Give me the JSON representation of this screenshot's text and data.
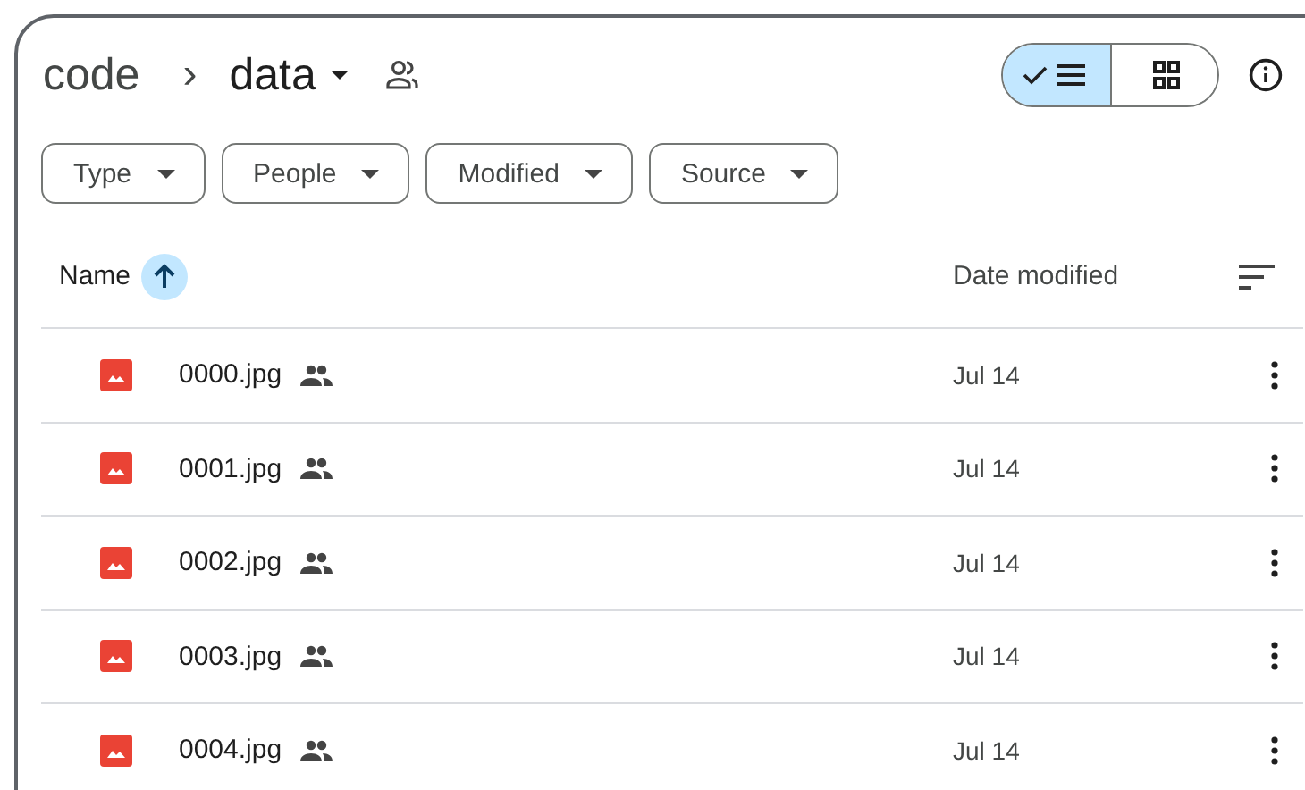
{
  "breadcrumb": {
    "parent": "code",
    "separator": "›",
    "current": "data"
  },
  "view_toggle": [
    {
      "kind": "list",
      "selected": true
    },
    {
      "kind": "grid",
      "selected": false
    }
  ],
  "filters": [
    {
      "label": "Type"
    },
    {
      "label": "People"
    },
    {
      "label": "Modified"
    },
    {
      "label": "Source"
    }
  ],
  "table": {
    "columns": [
      {
        "label": "Name",
        "sorted": true
      },
      {
        "label": "Date modified",
        "sorted": false
      }
    ],
    "rows": [
      {
        "name": "0000.jpg",
        "shared": true,
        "modified": "Jul 14"
      },
      {
        "name": "0001.jpg",
        "shared": true,
        "modified": "Jul 14"
      },
      {
        "name": "0002.jpg",
        "shared": true,
        "modified": "Jul 14"
      },
      {
        "name": "0003.jpg",
        "shared": true,
        "modified": "Jul 14"
      },
      {
        "name": "0004.jpg",
        "shared": true,
        "modified": "Jul 14"
      }
    ]
  }
}
